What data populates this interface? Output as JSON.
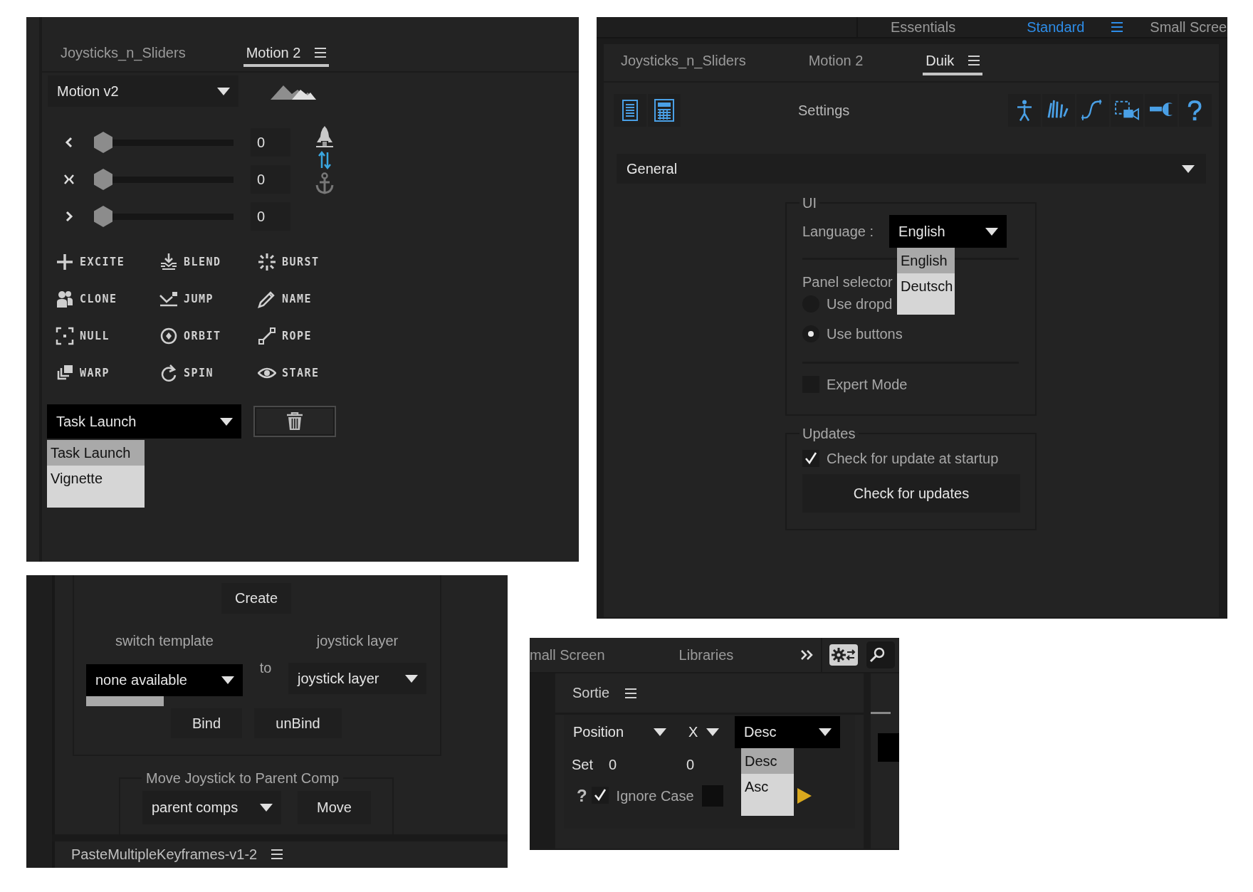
{
  "motion_panel": {
    "tabs": [
      {
        "label": "Joysticks_n_Sliders",
        "selected": false
      },
      {
        "label": "Motion 2",
        "selected": true
      }
    ],
    "preset": "Motion v2",
    "sliders": [
      {
        "level": 0,
        "value": "0"
      },
      {
        "level": 0,
        "value": "0"
      },
      {
        "level": 0,
        "value": "0"
      }
    ],
    "tools": [
      "EXCITE",
      "BLEND",
      "BURST",
      "CLONE",
      "JUMP",
      "NAME",
      "NULL",
      "ORBIT",
      "ROPE",
      "WARP",
      "SPIN",
      "STARE"
    ],
    "task_dropdown": {
      "value": "Task Launch",
      "options": [
        {
          "label": "Task Launch",
          "selected": true
        },
        {
          "label": "Vignette",
          "selected": false
        }
      ]
    }
  },
  "duik_panel": {
    "workspaces": [
      {
        "label": "Essentials",
        "selected": false
      },
      {
        "label": "Standard",
        "selected": true
      },
      {
        "label": "Small Scree",
        "selected": false
      }
    ],
    "tabs": [
      {
        "label": "Joysticks_n_Sliders",
        "selected": false
      },
      {
        "label": "Motion 2",
        "selected": false
      },
      {
        "label": "Duik",
        "selected": true
      }
    ],
    "title": "Settings",
    "section": "General",
    "ui_group": {
      "title": "UI",
      "language_label": "Language :",
      "language": {
        "value": "English",
        "options": [
          {
            "label": "English",
            "selected": true
          },
          {
            "label": "Deutsch",
            "selected": false
          }
        ]
      },
      "panel_selector_label": "Panel selector",
      "panel_selector": [
        {
          "label": "Use dropd",
          "selected": false
        },
        {
          "label": "Use buttons",
          "selected": true
        }
      ],
      "expert_mode": {
        "label": "Expert Mode",
        "checked": false
      }
    },
    "updates_group": {
      "title": "Updates",
      "check_at_startup": {
        "label": "Check for update at startup",
        "checked": true
      },
      "button": "Check for updates"
    }
  },
  "joystick_panel": {
    "create_button": "Create",
    "source_label": "switch template",
    "connector_label": "to",
    "target_label": "joystick layer",
    "source_dropdown": "none available",
    "target_dropdown": "joystick layer",
    "buttons": [
      "Bind",
      "unBind"
    ],
    "move_group": {
      "title": "Move Joystick to Parent Comp",
      "dropdown": "parent comps",
      "button": "Move"
    },
    "next_panel_tab": "PasteMultipleKeyframes-v1-2"
  },
  "sortie_panel": {
    "workspaces": [
      "mall Screen",
      "Libraries"
    ],
    "tab": "Sortie",
    "property_dropdown": "Position",
    "axis_dropdown": "X",
    "order_dropdown": {
      "value": "Desc",
      "options": [
        {
          "label": "Desc",
          "selected": true
        },
        {
          "label": "Asc",
          "selected": false
        }
      ]
    },
    "set_label": "Set",
    "set_values": [
      "0",
      "0"
    ],
    "help": "?",
    "ignore_case": {
      "label": "Ignore Case",
      "checked": true
    }
  }
}
